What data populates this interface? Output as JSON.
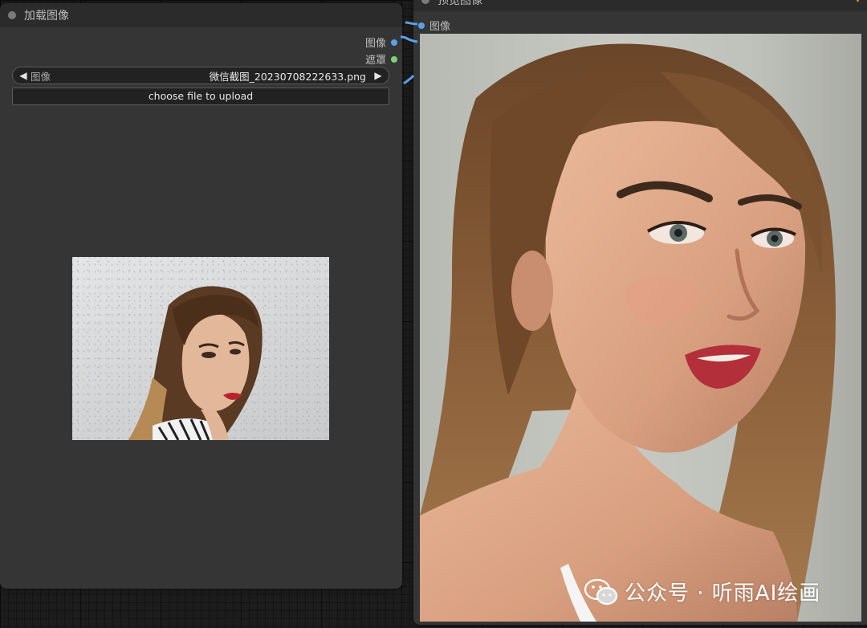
{
  "load_node": {
    "title": "加载图像",
    "outputs": [
      {
        "label": "图像",
        "color": "#5aa0ea"
      },
      {
        "label": "遮罩",
        "color": "#7dd07d"
      }
    ],
    "image_widget": {
      "label": "图像",
      "value": "微信截图_20230708222633.png",
      "prev_arrow": "◀",
      "next_arrow": "▶"
    },
    "upload_button": "choose file to upload",
    "thumbnail_icon": "woman-portrait-thumbnail"
  },
  "preview_node": {
    "title": "预览图像",
    "help": "?",
    "input": {
      "label": "图像",
      "color": "#5aa0ea"
    },
    "image_icon": "woman-portrait-preview"
  },
  "watermark": {
    "icon": "wechat-icon",
    "text": "公众号 · 听雨AI绘画"
  },
  "colors": {
    "node_bg": "#353535",
    "title_bg": "#2b2b2b",
    "link_image": "#5aa0ea",
    "help": "#d9a400"
  }
}
